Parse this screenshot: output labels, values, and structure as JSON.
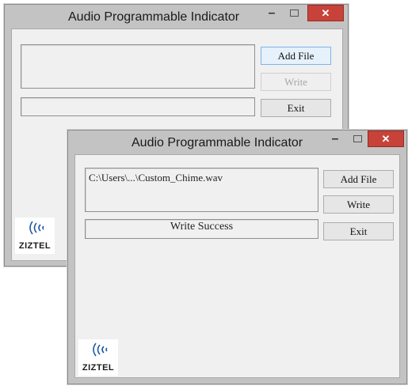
{
  "back_window": {
    "title": "Audio Programmable Indicator",
    "controls": {
      "minimize": "–",
      "close": "✕"
    },
    "file_display": "",
    "status_display": "",
    "buttons": {
      "add_file": "Add File",
      "write": "Write",
      "exit": "Exit"
    },
    "logo_text": "ZIZTEL"
  },
  "front_window": {
    "title": "Audio Programmable Indicator",
    "controls": {
      "minimize": "–",
      "close": "✕"
    },
    "file_display": "C:\\Users\\...\\Custom_Chime.wav",
    "status_display": "Write Success",
    "buttons": {
      "add_file": "Add File",
      "write": "Write",
      "exit": "Exit"
    },
    "logo_text": "ZIZTEL"
  },
  "colors": {
    "close_button": "#c7433a",
    "frame": "#c3c3c3",
    "client": "#f0f0f0",
    "logo_blue": "#1f5aa6"
  },
  "icons": {
    "logo": "ziztel-sound-waves-logo"
  }
}
